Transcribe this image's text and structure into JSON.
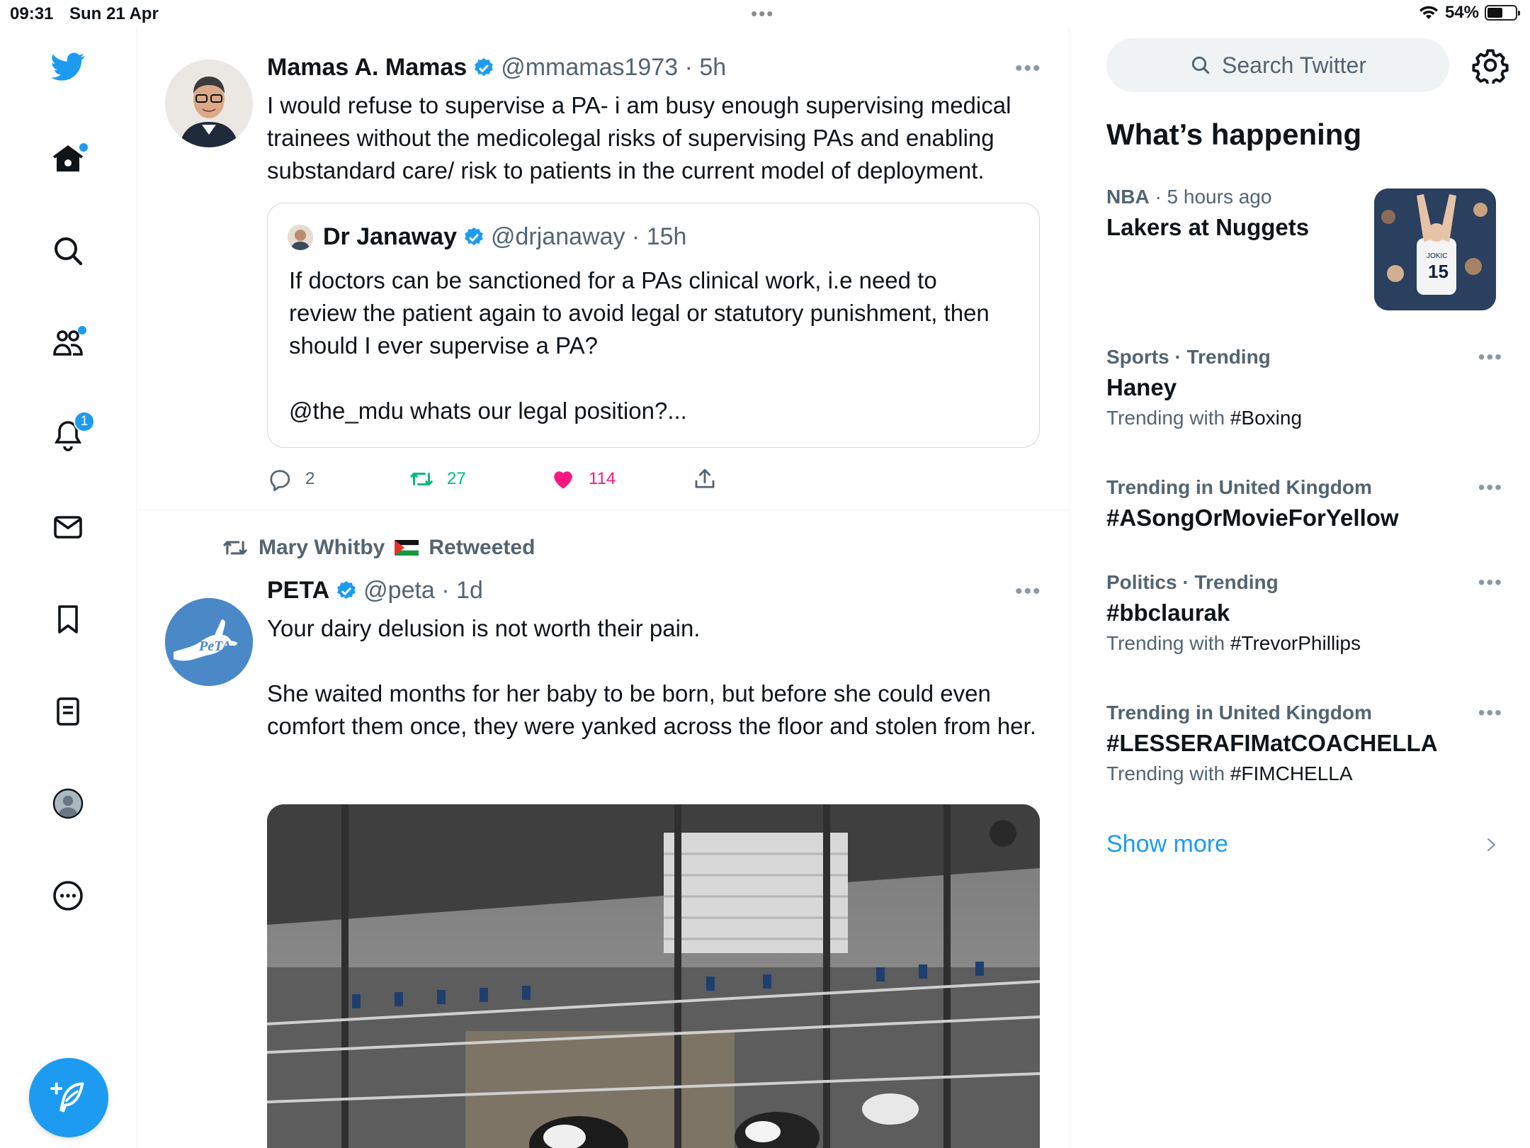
{
  "status_bar": {
    "time": "09:31",
    "date": "Sun 21 Apr",
    "battery": "54%",
    "battery_level": 0.54
  },
  "nav": {
    "items": [
      "twitter-logo",
      "home-icon",
      "search-icon",
      "communities-icon",
      "notifications-icon",
      "messages-icon",
      "bookmarks-icon",
      "lists-icon",
      "profile-icon",
      "more-icon"
    ],
    "notifications_badge": "1",
    "compose_icon": "compose-icon"
  },
  "tweets": [
    {
      "name": "Mamas A. Mamas",
      "handle": "@mmamas1973 · 5h",
      "text": "I would refuse to supervise a PA- i am busy enough supervising medical trainees without the medicolegal risks of supervising PAs and enabling substandard care/ risk to patients in the current model of deployment.",
      "quote": {
        "name": "Dr Janaway",
        "handle": "@drjanaway · 15h",
        "text": "If doctors can be sanctioned for a PAs clinical work, i.e need to review the patient again to avoid legal or statutory punishment, then should I ever supervise a PA?\n\n@the_mdu whats our legal position?..."
      },
      "replies": "2",
      "retweets": "27",
      "likes": "114"
    },
    {
      "retweeted_by": "Mary Whitby",
      "retweeted_label": "Retweeted",
      "name": "PETA",
      "handle": "@peta · 1d",
      "avatar_text": "PeTA",
      "text": "Your dairy delusion is not worth their pain.\n\nShe waited months for her baby to be born, but before she could even comfort them once, they were yanked across the floor and stolen from her."
    }
  ],
  "sidebar": {
    "search_placeholder": "Search Twitter",
    "section_title": "What’s happening",
    "trends": [
      {
        "meta": "NBA",
        "time": "· 5 hours ago",
        "title": "Lakers at Nuggets",
        "jersey": "15",
        "jersey_name": "JOKIC"
      },
      {
        "meta": "Sports · Trending",
        "title": "Haney",
        "sub_prefix": "Trending with ",
        "sub_tag": "#Boxing"
      },
      {
        "meta": "Trending in United Kingdom",
        "title": "#ASongOrMovieForYellow"
      },
      {
        "meta": "Politics · Trending",
        "title": "#bbclaurak",
        "sub_prefix": "Trending with ",
        "sub_tag": "#TrevorPhillips"
      },
      {
        "meta": "Trending in United Kingdom",
        "title": "#LESSERAFIMatCOACHELLA",
        "sub_prefix": "Trending with ",
        "sub_tag": "#FIMCHELLA"
      }
    ],
    "show_more": "Show more"
  },
  "colors": {
    "accent": "#1d9bf0",
    "retweet_green": "#00ba7c",
    "like_pink": "#f91880",
    "muted": "#536471"
  }
}
